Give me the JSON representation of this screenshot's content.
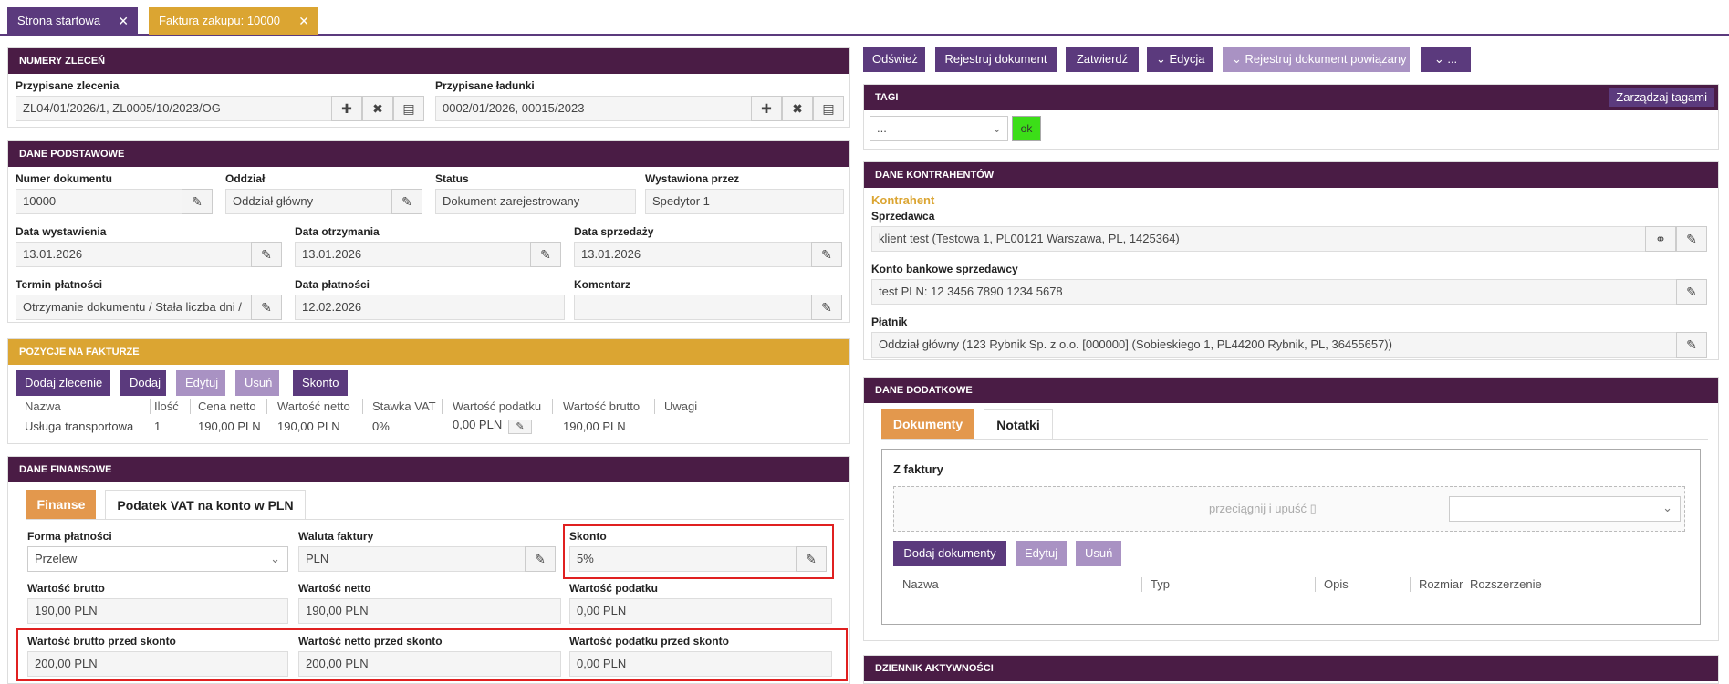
{
  "tabs": [
    {
      "label": "Strona startowa"
    },
    {
      "label": "Faktura zakupu: 10000"
    }
  ],
  "orders": {
    "header": "NUMERY ZLECEŃ",
    "assigned_orders_label": "Przypisane zlecenia",
    "assigned_orders_value": "ZL04/01/2026/1, ZL0005/10/2023/OG",
    "assigned_loads_label": "Przypisane ładunki",
    "assigned_loads_value": "0002/01/2026, 00015/2023"
  },
  "basic": {
    "header": "DANE PODSTAWOWE",
    "doc_number_label": "Numer dokumentu",
    "doc_number": "10000",
    "branch_label": "Oddział",
    "branch": "Oddział główny",
    "status_label": "Status",
    "status": "Dokument zarejestrowany",
    "issued_by_label": "Wystawiona przez",
    "issued_by": "Spedytor 1",
    "issue_date_label": "Data wystawienia",
    "issue_date": "13.01.2026",
    "receive_date_label": "Data otrzymania",
    "receive_date": "13.01.2026",
    "sale_date_label": "Data sprzedaży",
    "sale_date": "13.01.2026",
    "payment_term_label": "Termin płatności",
    "payment_term": "Otrzymanie dokumentu / Stała liczba dni /",
    "payment_date_label": "Data płatności",
    "payment_date": "12.02.2026",
    "comment_label": "Komentarz",
    "comment": ""
  },
  "items": {
    "header": "POZYCJE NA FAKTURZE",
    "buttons": {
      "add_order": "Dodaj zlecenie",
      "add": "Dodaj",
      "edit": "Edytuj",
      "delete": "Usuń",
      "skonto": "Skonto"
    },
    "columns": [
      "Nazwa",
      "Ilość",
      "Cena netto",
      "Wartość netto",
      "Stawka VAT",
      "Wartość podatku",
      "Wartość brutto",
      "Uwagi"
    ],
    "rows": [
      {
        "name": "Usługa transportowa",
        "qty": "1",
        "net_price": "190,00 PLN",
        "net_value": "190,00 PLN",
        "vat_rate": "0%",
        "tax_value": "0,00 PLN",
        "gross_value": "190,00 PLN",
        "notes": ""
      }
    ]
  },
  "finance": {
    "header": "DANE FINANSOWE",
    "tab_finance": "Finanse",
    "tab_vat": "Podatek VAT na konto w PLN",
    "payment_form_label": "Forma płatności",
    "payment_form": "Przelew",
    "currency_label": "Waluta faktury",
    "currency": "PLN",
    "skonto_label": "Skonto",
    "skonto": "5%",
    "gross_label": "Wartość brutto",
    "gross": "190,00 PLN",
    "net_label": "Wartość netto",
    "net": "190,00 PLN",
    "tax_label": "Wartość podatku",
    "tax": "0,00 PLN",
    "gross_before_label": "Wartość brutto przed skonto",
    "gross_before": "200,00 PLN",
    "net_before_label": "Wartość netto przed skonto",
    "net_before": "200,00 PLN",
    "tax_before_label": "Wartość podatku przed skonto",
    "tax_before": "0,00 PLN"
  },
  "toolbar": {
    "refresh": "Odśwież",
    "register": "Rejestruj dokument",
    "approve": "Zatwierdź",
    "edit": "Edycja",
    "register_related": "Rejestruj dokument powiązany",
    "more": "..."
  },
  "tags": {
    "header": "TAGI",
    "manage": "Zarządzaj tagami",
    "select_value": "...",
    "ok": "ok"
  },
  "contractors": {
    "header": "DANE KONTRAHENTÓW",
    "section": "Kontrahent",
    "seller_label": "Sprzedawca",
    "seller": "klient test (Testowa 1, PL00121 Warszawa, PL, 1425364)",
    "account_label": "Konto bankowe sprzedawcy",
    "account": "test PLN: 12 3456 7890 1234 5678",
    "payer_label": "Płatnik",
    "payer": "Oddział główny (123 Rybnik Sp. z o.o. [000000] (Sobieskiego 1, PL44200 Rybnik, PL, 36455657))"
  },
  "additional": {
    "header": "DANE DODATKOWE",
    "tab_docs": "Dokumenty",
    "tab_notes": "Notatki",
    "from_invoice": "Z faktury",
    "drop_text": "przeciągnij i upuść",
    "buttons": {
      "add_docs": "Dodaj dokumenty",
      "edit": "Edytuj",
      "delete": "Usuń"
    },
    "columns": [
      "Nazwa",
      "Typ",
      "Opis",
      "Rozmiar",
      "Rozszerzenie"
    ]
  },
  "activity": {
    "header": "DZIENNIK AKTYWNOŚCI"
  }
}
